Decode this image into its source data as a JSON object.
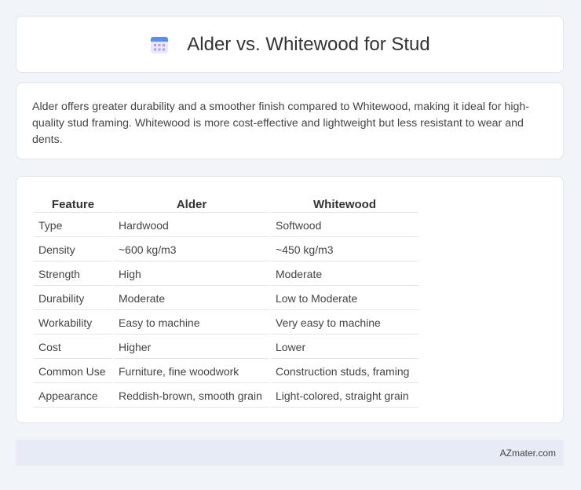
{
  "header": {
    "title": "Alder vs. Whitewood for Stud",
    "icon": "calendar-icon"
  },
  "summary": {
    "text": "Alder offers greater durability and a smoother finish compared to Whitewood, making it ideal for high-quality stud framing. Whitewood is more cost-effective and lightweight but less resistant to wear and dents."
  },
  "table": {
    "headers": [
      "Feature",
      "Alder",
      "Whitewood"
    ],
    "rows": [
      [
        "Type",
        "Hardwood",
        "Softwood"
      ],
      [
        "Density",
        "~600 kg/m3",
        "~450 kg/m3"
      ],
      [
        "Strength",
        "High",
        "Moderate"
      ],
      [
        "Durability",
        "Moderate",
        "Low to Moderate"
      ],
      [
        "Workability",
        "Easy to machine",
        "Very easy to machine"
      ],
      [
        "Cost",
        "Higher",
        "Lower"
      ],
      [
        "Common Use",
        "Furniture, fine woodwork",
        "Construction studs, framing"
      ],
      [
        "Appearance",
        "Reddish-brown, smooth grain",
        "Light-colored, straight grain"
      ]
    ]
  },
  "footer": {
    "brand": "AZmater.com"
  }
}
